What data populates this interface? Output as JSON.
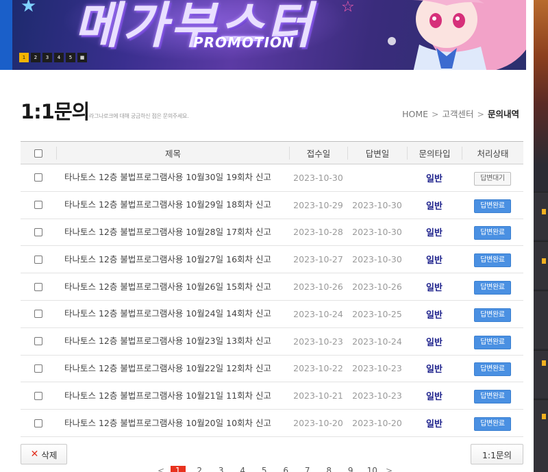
{
  "banner": {
    "title": "메가부스터",
    "promo": "PROMOTION",
    "slides": [
      "1",
      "2",
      "3",
      "4",
      "5",
      "■"
    ],
    "active_slide": 0
  },
  "header": {
    "title": "1:1문의",
    "subtitle": "라그나로크에 대해 궁금하신 점은 문의주세요.",
    "breadcrumb": [
      "HOME",
      "고객센터",
      "문의내역"
    ]
  },
  "table": {
    "columns": {
      "title": "제목",
      "registered": "접수일",
      "answered": "답변일",
      "type": "문의타입",
      "state": "처리상태"
    },
    "rows": [
      {
        "title": "타나토스 12층 불법프로그램사용 10월30일 19회차 신고",
        "registered": "2023-10-30",
        "answered": "",
        "type": "일반",
        "state": "답변대기",
        "state_kind": "wait"
      },
      {
        "title": "타나토스 12층 불법프로그램사용 10월29일 18회차 신고",
        "registered": "2023-10-29",
        "answered": "2023-10-30",
        "type": "일반",
        "state": "답변완료",
        "state_kind": "done"
      },
      {
        "title": "타나토스 12층 불법프로그램사용 10월28일 17회차 신고",
        "registered": "2023-10-28",
        "answered": "2023-10-30",
        "type": "일반",
        "state": "답변완료",
        "state_kind": "done"
      },
      {
        "title": "타나토스 12층 불법프로그램사용 10월27일 16회차 신고",
        "registered": "2023-10-27",
        "answered": "2023-10-30",
        "type": "일반",
        "state": "답변완료",
        "state_kind": "done"
      },
      {
        "title": "타나토스 12층 불법프로그램사용 10월26일 15회차 신고",
        "registered": "2023-10-26",
        "answered": "2023-10-26",
        "type": "일반",
        "state": "답변완료",
        "state_kind": "done"
      },
      {
        "title": "타나토스 12층 불법프로그램사용 10월24일 14회차 신고",
        "registered": "2023-10-24",
        "answered": "2023-10-25",
        "type": "일반",
        "state": "답변완료",
        "state_kind": "done"
      },
      {
        "title": "타나토스 12층 불법프로그램사용 10월23일 13회차 신고",
        "registered": "2023-10-23",
        "answered": "2023-10-24",
        "type": "일반",
        "state": "답변완료",
        "state_kind": "done"
      },
      {
        "title": "타나토스 12층 불법프로그램사용 10월22일 12회차 신고",
        "registered": "2023-10-22",
        "answered": "2023-10-23",
        "type": "일반",
        "state": "답변완료",
        "state_kind": "done"
      },
      {
        "title": "타나토스 12층 불법프로그램사용 10월21일 11회차 신고",
        "registered": "2023-10-21",
        "answered": "2023-10-23",
        "type": "일반",
        "state": "답변완료",
        "state_kind": "done"
      },
      {
        "title": "타나토스 12층 불법프로그램사용 10월20일 10회차 신고",
        "registered": "2023-10-20",
        "answered": "2023-10-20",
        "type": "일반",
        "state": "답변완료",
        "state_kind": "done"
      }
    ]
  },
  "actions": {
    "delete_label": "삭제",
    "inquiry_label": "1:1문의"
  },
  "pagination": {
    "prev": "<",
    "pages": [
      "1",
      "2",
      "3",
      "4",
      "5",
      "6",
      "7",
      "8",
      "9",
      "10"
    ],
    "current": "1",
    "next": ">"
  },
  "colors": {
    "accent_blue": "#4a90e2",
    "type_text": "#1a1e8a",
    "page_active": "#e8321e"
  }
}
